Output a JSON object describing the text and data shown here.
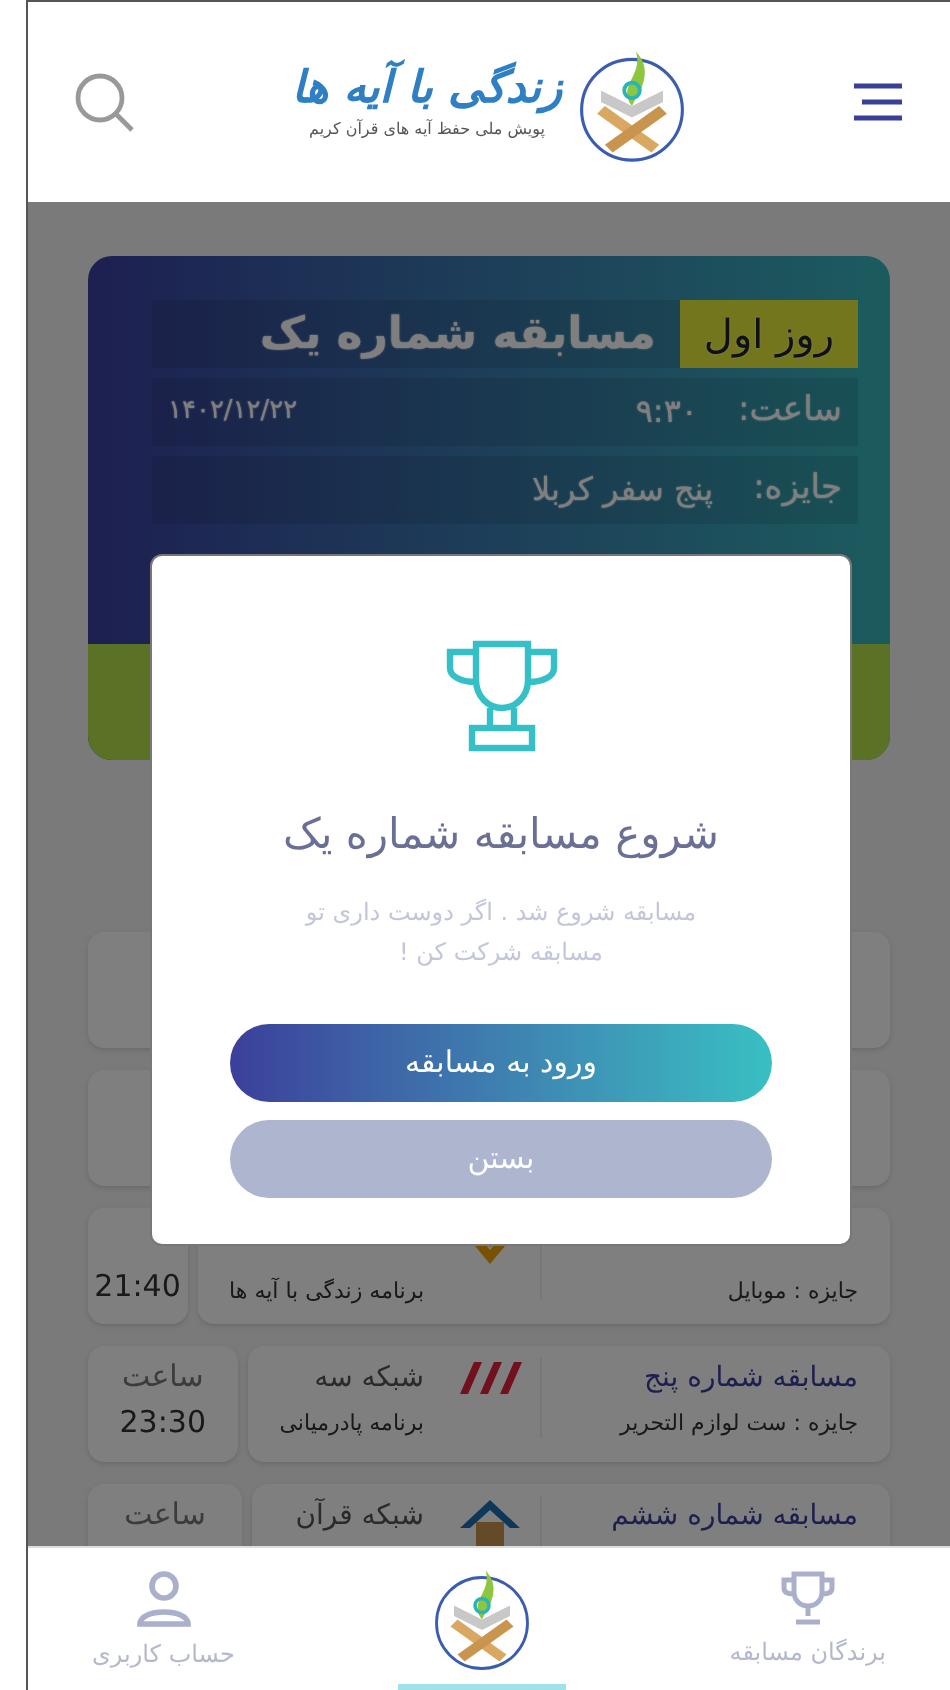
{
  "header": {
    "logo_title": "زندگی با آیه ها",
    "logo_subtitle": "پویش ملی حفظ آیه های قرآن کریم"
  },
  "featured": {
    "badge": "روز اول",
    "title": "مسابقه شماره یک",
    "time_label": "ساعت:",
    "time": "۹:۳۰",
    "date": "۱۴۰۲/۱۲/۲۲",
    "prize_label": "جایزه:",
    "prize": "پنج سفر کربلا"
  },
  "rows": [
    {},
    {},
    {
      "time_value": "21:40",
      "program": "برنامه زندگی با آیه ها",
      "prize": "جایزه : موبایل",
      "kind": "emblem"
    },
    {
      "time_label": "ساعت",
      "time_value": "23:30",
      "title": "مسابقه شماره پنج",
      "prize": "جایزه : ست لوازم التحریر",
      "channel": "شبکه سه",
      "program": "برنامه پادرمیانی",
      "kind": "stripes"
    },
    {
      "time_label": "ساعت",
      "title": "مسابقه شماره ششم",
      "channel": "شبکه قرآن",
      "kind": "dome"
    }
  ],
  "modal": {
    "title": "شروع مسابقه شماره یک",
    "message": "مسابقه  شروع شد . اگر دوست داری تو مسابقه شرکت کن !",
    "primary": "ورود به مسابقه",
    "secondary": "بستن"
  },
  "nav": [
    {
      "kind": "trophy",
      "label": "برندگان مسابقه",
      "selected": false
    },
    {
      "kind": "logo",
      "selected": true
    },
    {
      "kind": "user",
      "label": "حساب کاربری",
      "selected": false
    }
  ]
}
